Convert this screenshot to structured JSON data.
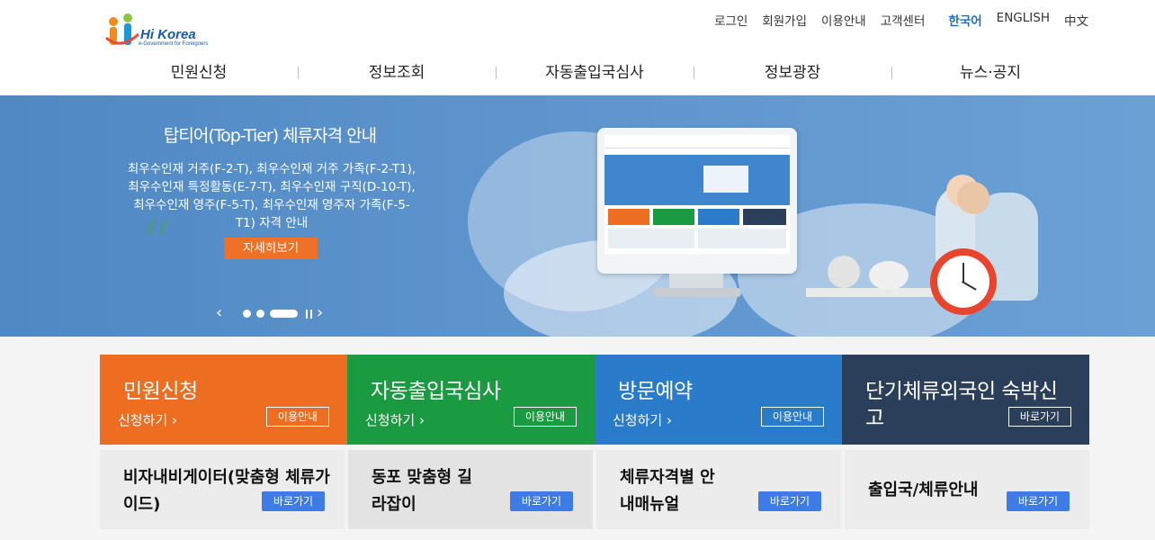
{
  "logo": {
    "brand": "Hi Korea",
    "tagline": "e-Government for Foreigners"
  },
  "topnav": {
    "login": "로그인",
    "signup": "회원가입",
    "guide": "이용안내",
    "support": "고객센터",
    "lang_ko": "한국어",
    "lang_en": "ENGLISH",
    "lang_zh": "中文"
  },
  "mainnav": [
    "민원신청",
    "정보조회",
    "자동출입국심사",
    "정보광장",
    "뉴스·공지"
  ],
  "banner": {
    "title": "탑티어(Top-Tier) 체류자격 안내",
    "desc": "최우수인재 거주(F-2-T), 최우수인재 거주 가족(F-2-T1), 최우수인재 특정활동(E-7-T), 최우수인재 구직(D-10-T), 최우수인재 영주(F-5-T), 최우수인재 영주자 가족(F-5-T1) 자격 안내",
    "button": "자세히보기",
    "prev": "‹",
    "next": "›"
  },
  "cards": [
    {
      "title": "민원신청",
      "sub": "신청하기",
      "btn": "이용안내",
      "color": "#ee6e21"
    },
    {
      "title": "자동출입국심사",
      "sub": "신청하기",
      "btn": "이용안내",
      "color": "#1a9a41"
    },
    {
      "title": "방문예약",
      "sub": "신청하기",
      "btn": "이용안내",
      "color": "#2b7bcb"
    },
    {
      "title": "단기체류외국인 숙박신고",
      "btn": "바로가기",
      "color": "#2b3e5a"
    }
  ],
  "guides": [
    {
      "title": "비자내비게이터(맞춤형 체류가이드)",
      "btn": "바로가기"
    },
    {
      "title": "동포 맞춤형 길라잡이",
      "btn": "바로가기"
    },
    {
      "title": "체류자격별 안내매뉴얼",
      "btn": "바로가기"
    },
    {
      "title": "출입국/체류안내",
      "btn": "바로가기"
    }
  ]
}
